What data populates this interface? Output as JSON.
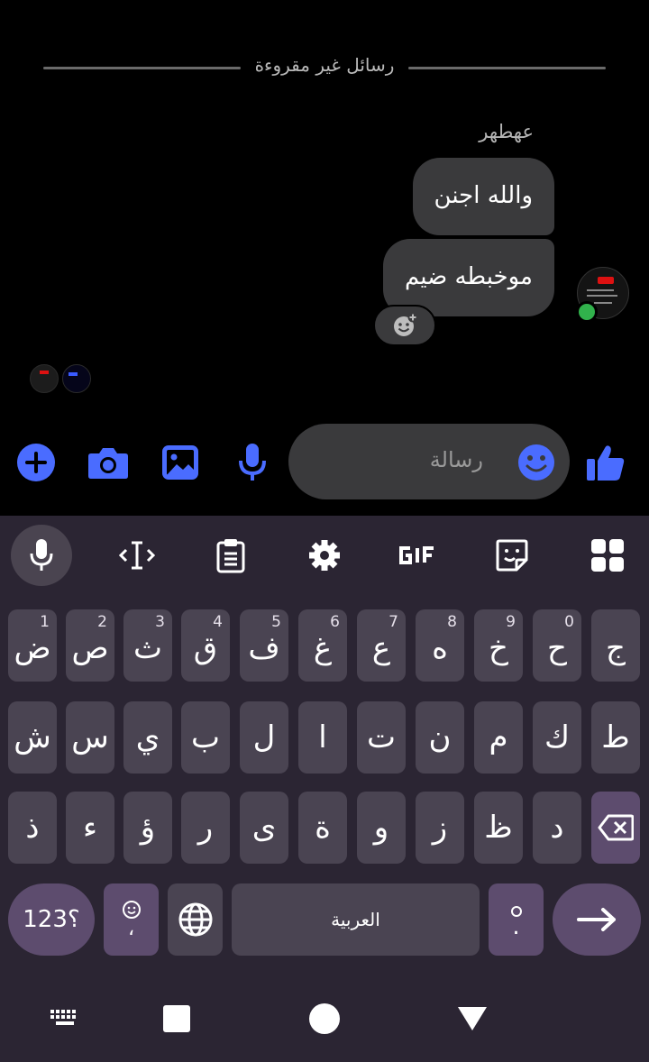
{
  "chat": {
    "divider_text": "رسائل غير مقروءة",
    "sender_name": "عهطهر",
    "messages": [
      {
        "text": "والله اجنن"
      },
      {
        "text": "موخبطه ضيم"
      }
    ]
  },
  "composer": {
    "placeholder": "رسالة"
  },
  "keyboard": {
    "row1": [
      {
        "ch": "ج",
        "hint": ""
      },
      {
        "ch": "ح",
        "hint": "0"
      },
      {
        "ch": "خ",
        "hint": "9"
      },
      {
        "ch": "ه",
        "hint": "8"
      },
      {
        "ch": "ع",
        "hint": "7"
      },
      {
        "ch": "غ",
        "hint": "6"
      },
      {
        "ch": "ف",
        "hint": "5"
      },
      {
        "ch": "ق",
        "hint": "4"
      },
      {
        "ch": "ث",
        "hint": "3"
      },
      {
        "ch": "ص",
        "hint": "2"
      },
      {
        "ch": "ض",
        "hint": "1"
      }
    ],
    "row2": [
      "ط",
      "ك",
      "م",
      "ن",
      "ت",
      "ا",
      "ل",
      "ب",
      "ي",
      "س",
      "ش"
    ],
    "row3": [
      "د",
      "ظ",
      "ز",
      "و",
      "ة",
      "ى",
      "ر",
      "ؤ",
      "ء",
      "ذ"
    ],
    "sym_label": "؟123",
    "comma_label": "،",
    "space_label": "العربية",
    "period_label": "."
  },
  "colors": {
    "accent": "#4a6cff",
    "bubble": "#3a3a3c",
    "keyboard_bg": "#2b2533",
    "key_bg": "#4a4452",
    "key_special": "#5d4c6e",
    "online": "#31b24c"
  },
  "icons": {
    "composer": [
      "plus-icon",
      "camera-icon",
      "image-icon",
      "mic-icon",
      "emoji-icon",
      "thumbs-up-icon"
    ],
    "keyboard_toolbar": [
      "mic-icon",
      "text-cursor-icon",
      "clipboard-icon",
      "gear-icon",
      "gif-icon",
      "sticker-icon",
      "grid-icon"
    ],
    "nav": [
      "keyboard-hide-icon",
      "recents-icon",
      "home-icon",
      "back-icon"
    ]
  }
}
